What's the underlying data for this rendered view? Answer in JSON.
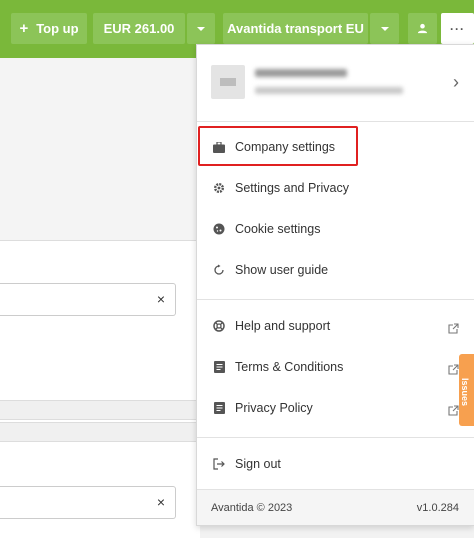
{
  "topbar": {
    "topup_label": "Top up",
    "balance_label": "EUR 261.00",
    "company_label": "Avantida transport EU",
    "accent_color": "#7ab83a"
  },
  "menu": {
    "items": [
      {
        "label": "Company settings",
        "icon": "briefcase-icon"
      },
      {
        "label": "Settings and Privacy",
        "icon": "gear-icon"
      },
      {
        "label": "Cookie settings",
        "icon": "cookie-icon"
      },
      {
        "label": "Show user guide",
        "icon": "refresh-icon"
      },
      {
        "label": "Help and support",
        "icon": "lifebuoy-icon"
      },
      {
        "label": "Terms & Conditions",
        "icon": "document-icon"
      },
      {
        "label": "Privacy Policy",
        "icon": "document-icon"
      },
      {
        "label": "Sign out",
        "icon": "sign-out-icon"
      }
    ],
    "footer_copyright": "Avantida © 2023",
    "footer_version": "v1.0.284"
  },
  "background": {
    "clear_symbol": "×"
  },
  "feedback_tab": {
    "label": "Issues"
  }
}
